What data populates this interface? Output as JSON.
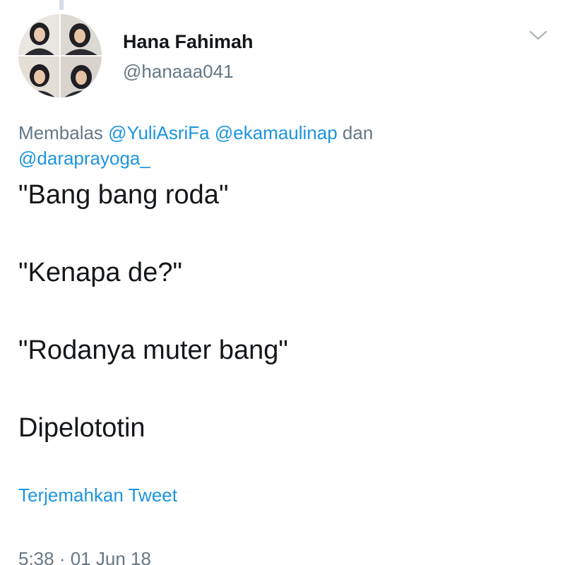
{
  "author": {
    "display_name": "Hana Fahimah",
    "handle": "@hanaaa041",
    "avatar_icon": "profile-photo-collage"
  },
  "menu": {
    "icon": "chevron-down-icon"
  },
  "reply_context": {
    "prefix": "Membalas",
    "mention_1": "@YuliAsriFa",
    "mention_2": "@ekamaulinap",
    "conjunction": "dan",
    "mention_3": "@daraprayoga_"
  },
  "tweet": {
    "lines": [
      "\"Bang bang roda\"",
      "\"Kenapa de?\"",
      "\"Rodanya muter bang\"",
      "Dipelototin"
    ]
  },
  "translate_label": "Terjemahkan Tweet",
  "timestamp": "5:38 · 01 Jun 18",
  "colors": {
    "link": "#1b95e0",
    "muted": "#657786",
    "text": "#14171a"
  }
}
